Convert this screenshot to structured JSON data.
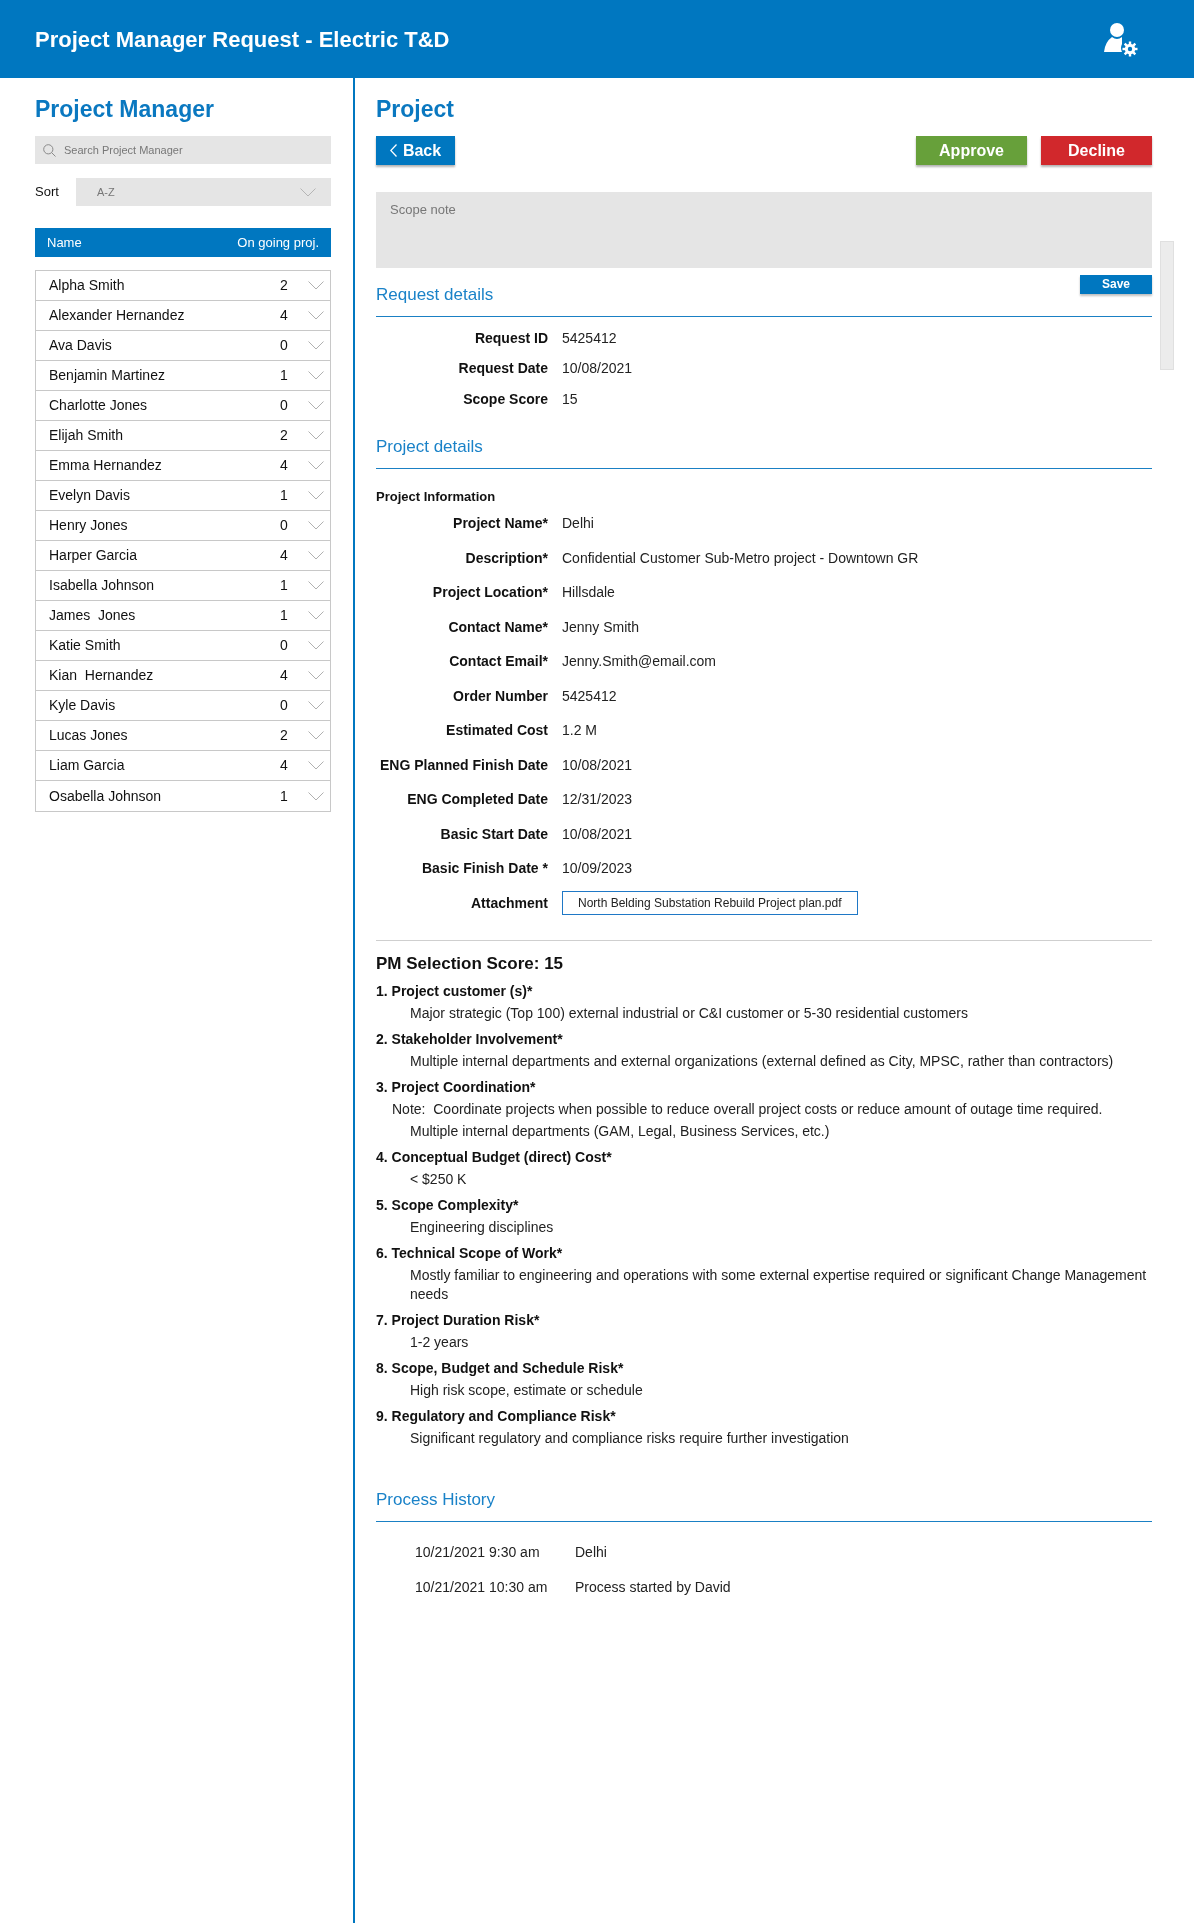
{
  "header": {
    "title": "Project Manager Request - Electric T&D"
  },
  "sidebar": {
    "title": "Project Manager",
    "search": {
      "placeholder": "Search Project Manager"
    },
    "sort": {
      "label": "Sort",
      "value": "A-Z"
    },
    "columns": [
      "Name",
      "On going proj."
    ],
    "managers": [
      {
        "name": "Alpha Smith",
        "count": "2"
      },
      {
        "name": "Alexander Hernandez",
        "count": "4"
      },
      {
        "name": "Ava Davis",
        "count": "0"
      },
      {
        "name": "Benjamin Martinez",
        "count": "1"
      },
      {
        "name": "Charlotte Jones",
        "count": "0"
      },
      {
        "name": "Elijah Smith",
        "count": "2"
      },
      {
        "name": "Emma Hernandez",
        "count": "4"
      },
      {
        "name": "Evelyn Davis",
        "count": "1"
      },
      {
        "name": "Henry Jones",
        "count": "0"
      },
      {
        "name": "Harper Garcia",
        "count": "4"
      },
      {
        "name": "Isabella Johnson",
        "count": "1"
      },
      {
        "name": "James  Jones",
        "count": "1"
      },
      {
        "name": "Katie Smith",
        "count": "0"
      },
      {
        "name": "Kian  Hernandez",
        "count": "4"
      },
      {
        "name": "Kyle Davis",
        "count": "0"
      },
      {
        "name": "Lucas Jones",
        "count": "2"
      },
      {
        "name": "Liam Garcia",
        "count": "4"
      },
      {
        "name": "Osabella Johnson",
        "count": "1"
      }
    ]
  },
  "project": {
    "title": "Project",
    "buttons": [
      {
        "kind": "back",
        "label": "Back"
      },
      {
        "kind": "approve",
        "label": "Approve"
      },
      {
        "kind": "decline",
        "label": "Decline"
      }
    ],
    "scope_note": {
      "placeholder": "Scope note"
    },
    "save_button": "Save",
    "request_details": {
      "title": "Request details",
      "fields": [
        {
          "kind": "text",
          "label": "Request ID",
          "value": "5425412"
        },
        {
          "kind": "text",
          "label": "Request Date",
          "value": "10/08/2021"
        },
        {
          "kind": "text",
          "label": "Scope Score",
          "value": "15"
        }
      ]
    },
    "project_details": {
      "title": "Project details",
      "subtitle": "Project Information",
      "fields": [
        {
          "kind": "text",
          "label": "Project Name*",
          "value": "Delhi"
        },
        {
          "kind": "text",
          "label": "Description*",
          "value": "Confidential Customer Sub-Metro project - Downtown GR"
        },
        {
          "kind": "text",
          "label": "Project Location*",
          "value": "Hillsdale"
        },
        {
          "kind": "text",
          "label": "Contact Name*",
          "value": "Jenny Smith"
        },
        {
          "kind": "text",
          "label": "Contact Email*",
          "value": "Jenny.Smith@email.com"
        },
        {
          "kind": "text",
          "label": "Order Number",
          "value": "5425412"
        },
        {
          "kind": "text",
          "label": "Estimated Cost",
          "value": "1.2 M"
        },
        {
          "kind": "text",
          "label": "ENG Planned Finish Date",
          "value": "10/08/2021"
        },
        {
          "kind": "text",
          "label": "ENG Completed Date",
          "value": "12/31/2023"
        },
        {
          "kind": "text",
          "label": "Basic Start Date",
          "value": "10/08/2021"
        },
        {
          "kind": "text",
          "label": "Basic Finish Date *",
          "value": "10/09/2023"
        },
        {
          "kind": "file",
          "label": "Attachment",
          "value": "North Belding Substation Rebuild Project plan.pdf"
        }
      ]
    },
    "pm_selection": {
      "title": "PM Selection Score: 15",
      "criteria": [
        {
          "title": "1. Project customer (s)*",
          "lines": [
            {
              "kind": "answer",
              "text": "Major strategic (Top 100) external industrial or C&I customer or 5-30 residential customers"
            }
          ]
        },
        {
          "title": "2. Stakeholder Involvement*",
          "lines": [
            {
              "kind": "answer",
              "text": "Multiple internal departments and external organizations (external defined as City, MPSC, rather than contractors)"
            }
          ]
        },
        {
          "title": "3. Project Coordination*",
          "lines": [
            {
              "kind": "note",
              "text": "Note:  Coordinate projects when possible to reduce overall project costs or reduce amount of outage time required."
            },
            {
              "kind": "answer",
              "text": "Multiple internal departments (GAM, Legal, Business Services, etc.)"
            }
          ]
        },
        {
          "title": "4. Conceptual Budget (direct) Cost*",
          "lines": [
            {
              "kind": "answer",
              "text": "< $250 K"
            }
          ]
        },
        {
          "title": "5. Scope Complexity*",
          "lines": [
            {
              "kind": "answer",
              "text": "Engineering disciplines"
            }
          ]
        },
        {
          "title": "6. Technical Scope of Work*",
          "lines": [
            {
              "kind": "answer",
              "text": "Mostly familiar to engineering and operations with some external expertise required or significant Change Management needs"
            }
          ]
        },
        {
          "title": "7. Project Duration Risk*",
          "lines": [
            {
              "kind": "answer",
              "text": "1-2 years"
            }
          ]
        },
        {
          "title": "8. Scope, Budget and Schedule Risk*",
          "lines": [
            {
              "kind": "answer",
              "text": "High risk scope, estimate or schedule"
            }
          ]
        },
        {
          "title": "9. Regulatory and Compliance Risk*",
          "lines": [
            {
              "kind": "answer",
              "text": "Significant regulatory and compliance risks require further investigation"
            }
          ]
        }
      ]
    },
    "process_history": {
      "title": "Process History",
      "entries": [
        {
          "time": "10/21/2021 9:30 am",
          "text": "Delhi"
        },
        {
          "time": "10/21/2021 10:30 am",
          "text": "Process started by David"
        }
      ]
    }
  }
}
